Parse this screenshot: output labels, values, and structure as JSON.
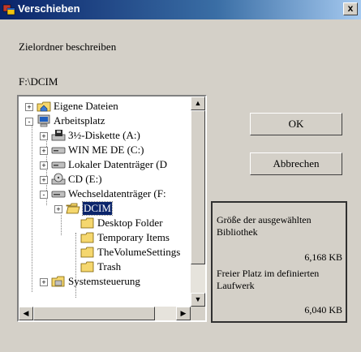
{
  "window": {
    "title": "Verschieben",
    "close_label": "x"
  },
  "instruction": "Zielordner beschreiben",
  "current_path": "F:\\DCIM",
  "tree": {
    "items": [
      {
        "label": "Eigene Dateien",
        "icon": "folder-home-icon",
        "expander": "+"
      },
      {
        "label": "Arbeitsplatz",
        "icon": "computer-icon",
        "expander": "-"
      },
      {
        "label": "3½-Diskette (A:)",
        "icon": "floppy-drive-icon",
        "expander": "+"
      },
      {
        "label": "WIN ME DE (C:)",
        "icon": "hard-drive-icon",
        "expander": "+"
      },
      {
        "label": "Lokaler Datenträger (D",
        "icon": "hard-drive-icon",
        "expander": "+"
      },
      {
        "label": "CD (E:)",
        "icon": "cd-drive-icon",
        "expander": "+"
      },
      {
        "label": "Wechseldatenträger (F:",
        "icon": "removable-drive-icon",
        "expander": "-"
      },
      {
        "label": "DCIM",
        "icon": "folder-open-icon",
        "expander": "+",
        "selected": true
      },
      {
        "label": "Desktop Folder",
        "icon": "folder-icon"
      },
      {
        "label": "Temporary Items",
        "icon": "folder-icon"
      },
      {
        "label": "TheVolumeSettings",
        "icon": "folder-icon"
      },
      {
        "label": "Trash",
        "icon": "folder-icon"
      },
      {
        "label": "Systemsteuerung",
        "icon": "control-panel-icon",
        "expander": "+"
      }
    ]
  },
  "buttons": {
    "ok": "OK",
    "cancel": "Abbrechen"
  },
  "info": {
    "selected_label": "Größe der ausgewählten Bibliothek",
    "selected_size": "6,168  KB",
    "free_label": "Freier Platz im definierten Laufwerk",
    "free_size": "6,040  KB"
  },
  "colors": {
    "title_bar": "#0a246a",
    "selection": "#0a246a",
    "dialog_bg": "#d4d0c8"
  }
}
